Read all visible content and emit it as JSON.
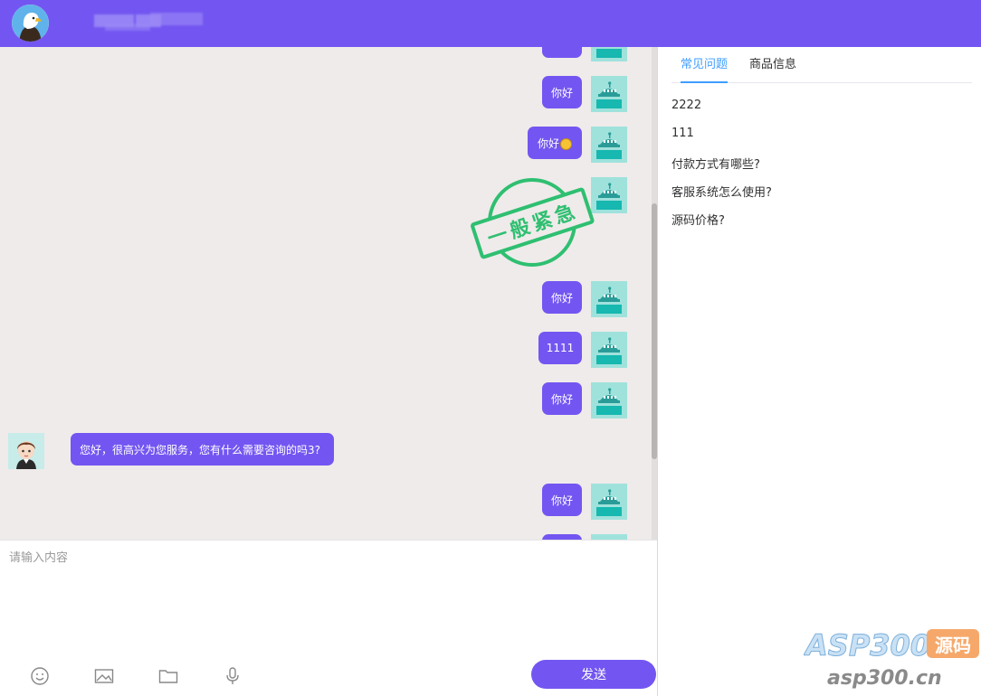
{
  "colors": {
    "brand": "#7356f1",
    "chat_bg": "#efebea",
    "stamp": "#2fbf71",
    "tab_active": "#409eff"
  },
  "header": {
    "logo_icon": "eagle-logo-icon",
    "title_blurred": true
  },
  "messages": [
    {
      "side": "right",
      "text": ""
    },
    {
      "side": "right",
      "text": "你好"
    },
    {
      "side": "right",
      "text": "你好",
      "emoji": "smile-emoji-icon"
    },
    {
      "side": "right",
      "text": "",
      "stamp": {
        "text": "一般紧急"
      }
    },
    {
      "side": "right",
      "text": "你好"
    },
    {
      "side": "right",
      "text": "1111"
    },
    {
      "side": "right",
      "text": "你好"
    },
    {
      "side": "left",
      "text": "您好，很高兴为您服务，您有什么需要咨询的吗3?"
    },
    {
      "side": "right",
      "text": "你好"
    },
    {
      "side": "right",
      "text": ""
    }
  ],
  "input": {
    "placeholder": "请输入内容",
    "value": ""
  },
  "toolbar": {
    "icons": [
      "emoji-icon",
      "image-icon",
      "folder-icon",
      "microphone-icon"
    ],
    "send_label": "发送"
  },
  "side": {
    "tabs": [
      {
        "label": "常见问题",
        "active": true
      },
      {
        "label": "商品信息",
        "active": false
      }
    ],
    "faq": [
      "2222",
      "111",
      "付款方式有哪些?",
      "客服系统怎么使用?",
      "源码价格?"
    ]
  },
  "watermark": {
    "brand": "ASP300",
    "badge": "源码",
    "domain": "asp300.cn"
  }
}
